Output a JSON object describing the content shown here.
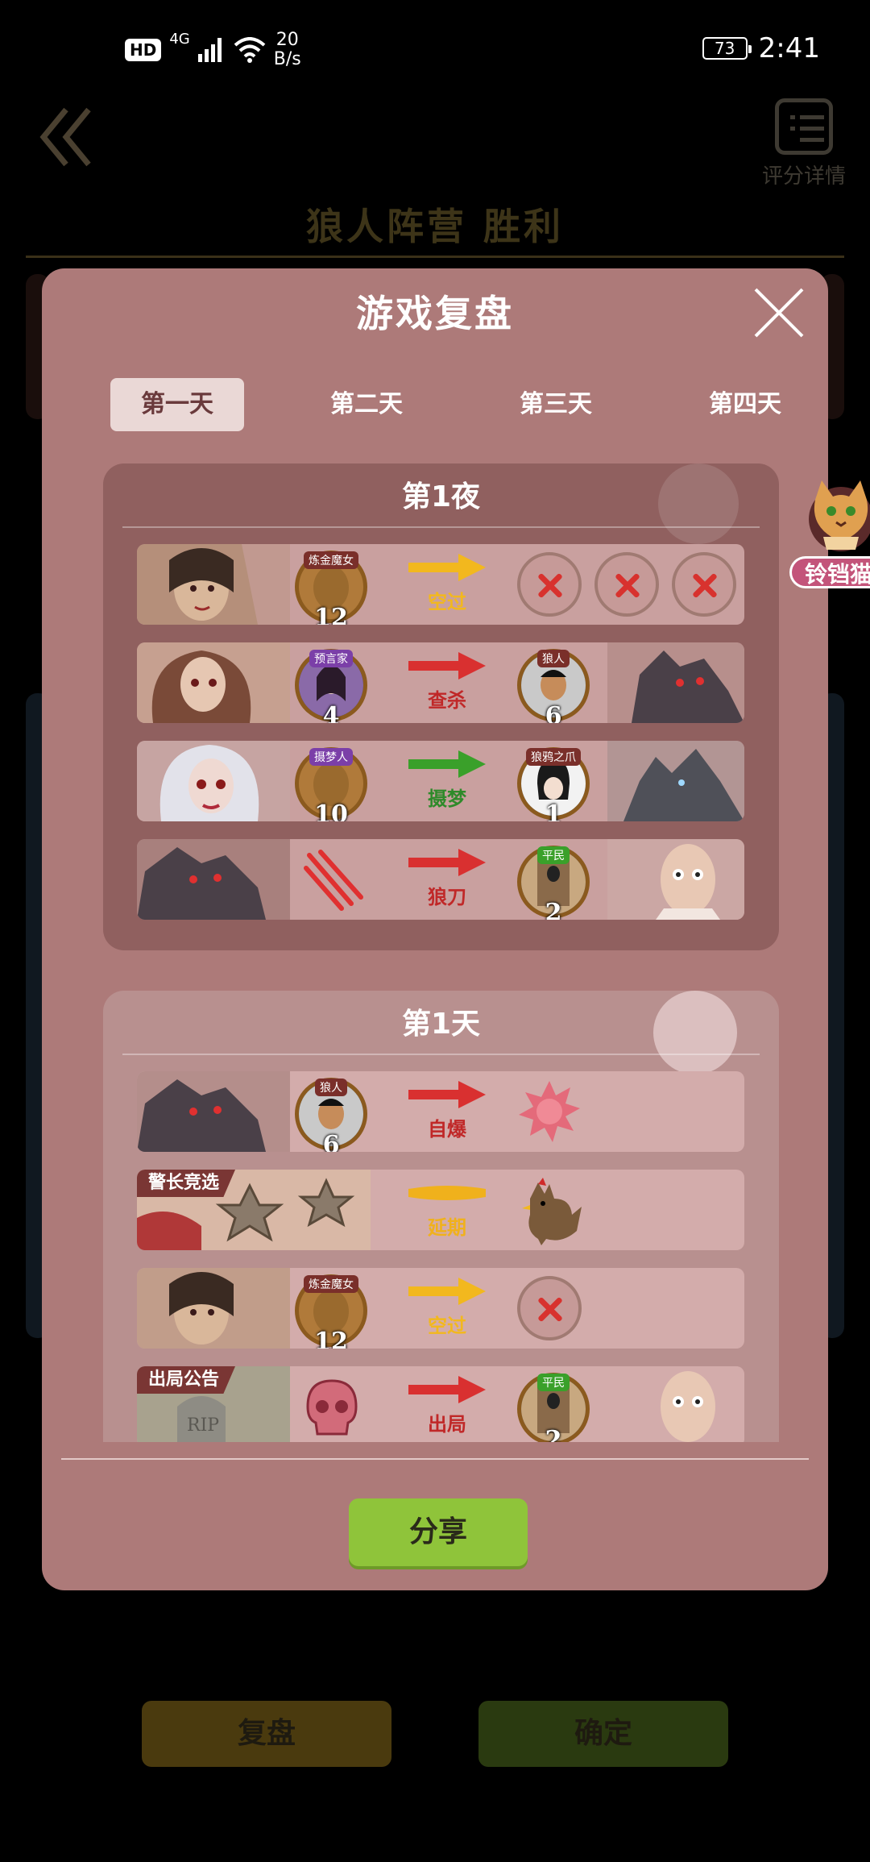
{
  "status_bar": {
    "hd": "HD",
    "network": "4G",
    "speed_value": "20",
    "speed_unit": "B/s",
    "battery": "73",
    "time": "2:41"
  },
  "background": {
    "result_title": "狼人阵营  胜利",
    "detail_label": "评分详情",
    "review_button": "复盘",
    "confirm_button": "确定"
  },
  "modal": {
    "title": "游戏复盘",
    "tabs": [
      "第一天",
      "第二天",
      "第三天",
      "第四天"
    ],
    "active_tab": 0,
    "night": {
      "title": "第1夜",
      "rows": [
        {
          "role_tag": "炼金魔女",
          "number": "12",
          "action": "空过"
        },
        {
          "role_tag": "预言家",
          "number": "4",
          "action": "查杀",
          "target_tag": "狼人",
          "target_number": "6"
        },
        {
          "role_tag": "摄梦人",
          "number": "10",
          "action": "摄梦",
          "target_tag": "狼鸦之爪",
          "target_number": "1"
        },
        {
          "action": "狼刀",
          "target_tag": "平民",
          "target_number": "2"
        }
      ]
    },
    "day": {
      "title": "第1天",
      "rows": [
        {
          "role_tag": "狼人",
          "number": "6",
          "action": "自爆"
        },
        {
          "banner": "警长竞选",
          "action": "延期"
        },
        {
          "role_tag": "炼金魔女",
          "number": "12",
          "action": "空过"
        },
        {
          "banner": "出局公告",
          "action": "出局",
          "target_tag": "平民",
          "target_number": "2"
        }
      ]
    },
    "share_button": "分享"
  },
  "floating_user": {
    "name": "铃铛猫"
  },
  "colors": {
    "modal_bg": "#ad7a79",
    "share_green": "#8fc43a",
    "arrow_red": "#d93030",
    "arrow_yellow": "#f2b81e",
    "arrow_green": "#3aa02a"
  }
}
